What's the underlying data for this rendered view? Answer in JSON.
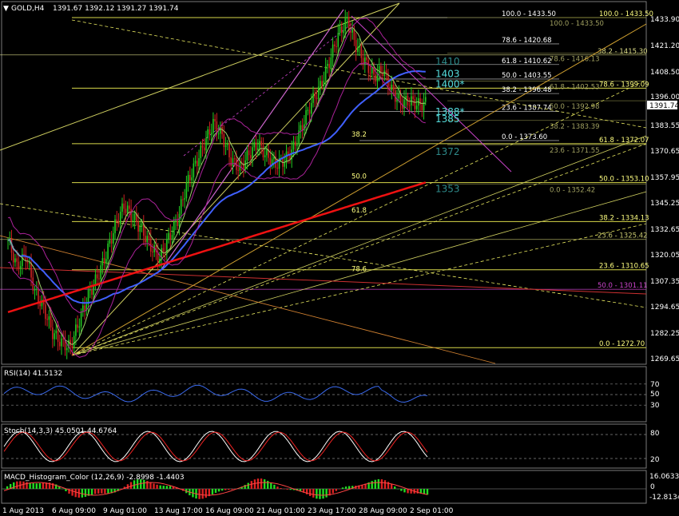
{
  "chart_data": {
    "type": "candlestick",
    "symbol_label": "GOLD,H4",
    "ohlc_label": "1391.67 1392.12 1391.27 1391.74",
    "last_price": "1391.74",
    "price_axis": [
      "1433.90",
      "1421.20",
      "1408.50",
      "1396.00",
      "1383.55",
      "1370.65",
      "1357.95",
      "1345.25",
      "1332.65",
      "1320.05",
      "1307.35",
      "1294.65",
      "1282.25",
      "1269.65"
    ],
    "time_axis": [
      "1 Aug 2013",
      "6 Aug 09:00",
      "9 Aug 01:00",
      "13 Aug 17:00",
      "16 Aug 09:00",
      "21 Aug 01:00",
      "23 Aug 17:00",
      "28 Aug 09:00",
      "2 Sep 01:00"
    ],
    "price_range": [
      1265.0,
      1440.5
    ],
    "close_path": [
      1325,
      1312,
      1318,
      1300,
      1292,
      1280,
      1275,
      1273,
      1286,
      1298,
      1307,
      1318,
      1332,
      1342,
      1336,
      1330,
      1322,
      1316,
      1326,
      1335,
      1352,
      1362,
      1372,
      1382,
      1376,
      1364,
      1360,
      1367,
      1372,
      1366,
      1362,
      1364,
      1370,
      1381,
      1392,
      1400,
      1412,
      1425,
      1432,
      1420,
      1412,
      1405,
      1408,
      1398,
      1392,
      1393,
      1391,
      1392
    ],
    "fib_levels_gold": [
      {
        "label": "100.0 - 1433.50",
        "price": 1433.5
      },
      {
        "label": "78.6 - 1399.09",
        "price": 1399.09
      },
      {
        "label": "61.8 - 1372.07",
        "price": 1372.07
      },
      {
        "label": "50.0 - 1353.10",
        "price": 1353.1
      },
      {
        "label": "38.2 - 1334.13",
        "price": 1334.13
      },
      {
        "label": "23.6 - 1310.65",
        "price": 1310.65
      },
      {
        "label": "0.0 - 1272.70",
        "price": 1272.7
      }
    ],
    "fib_levels_white": [
      {
        "label": "100.0 - 1433.50",
        "price": 1433.5
      },
      {
        "label": "78.6 - 1420.68",
        "price": 1420.68
      },
      {
        "label": "61.8 - 1410.62",
        "price": 1410.62
      },
      {
        "label": "50.0 - 1403.55",
        "price": 1403.55
      },
      {
        "label": "38.2 - 1396.48",
        "price": 1396.48
      },
      {
        "label": "23.6 - 1387.74",
        "price": 1387.74
      },
      {
        "label": "0.0 - 1373.60",
        "price": 1373.6
      }
    ],
    "fib_levels_dim": [
      {
        "label": "100.0 - 1433.50",
        "price": 1433.5
      },
      {
        "label": "78.6 - 1416.13",
        "price": 1416.13
      },
      {
        "label": "61.8 - 1402.53",
        "price": 1402.53
      },
      {
        "label": "50.0 - 1392.98",
        "price": 1392.98
      },
      {
        "label": "38.2 - 1383.39",
        "price": 1383.39
      },
      {
        "label": "23.6 - 1371.55",
        "price": 1371.55
      },
      {
        "label": "0.0 - 1352.42",
        "price": 1352.42
      }
    ],
    "fib_levels_extra": [
      {
        "label": "38.2 - 1415.30",
        "price": 1415.3,
        "color": "#dddd88"
      },
      {
        "label": "23.6 - 1325.42",
        "price": 1325.42,
        "color": "#c8c870"
      },
      {
        "label": "50.0 - 1301.11",
        "price": 1301.11,
        "color": "#cc44cc"
      }
    ],
    "mid_fib_labels": [
      {
        "label": "38.2",
        "price": 1375.5
      },
      {
        "label": "50.0",
        "price": 1355.0
      },
      {
        "label": "61.8",
        "price": 1338.5
      },
      {
        "label": "78.6",
        "price": 1310.0
      }
    ],
    "level_marks": [
      {
        "label": "1410",
        "price": 1410.5,
        "color": "#2e8a8a"
      },
      {
        "label": "1403",
        "price": 1404.5,
        "color": "#55dddd"
      },
      {
        "label": "1400*",
        "price": 1399.5,
        "color": "#55dddd"
      },
      {
        "label": "1388*",
        "price": 1386.0,
        "color": "#55dddd"
      },
      {
        "label": "1385",
        "price": 1382.5,
        "color": "#55dddd"
      },
      {
        "label": "1372",
        "price": 1366.5,
        "color": "#2e8a8a"
      },
      {
        "label": "1353",
        "price": 1348.5,
        "color": "#2e8a8a"
      }
    ],
    "rsi": {
      "label": "RSI(14) 41.5132",
      "levels": [
        "70",
        "50",
        "30"
      ],
      "value": 41.5132
    },
    "stoch": {
      "label": "Stoch(14,3,3) 45.0501 44.6764",
      "levels": [
        "80",
        "20"
      ]
    },
    "macd": {
      "label": "MACD_Histogram_Color (12,26,9) -2.8998 -1.4403",
      "levels": [
        "16.0633",
        "0",
        "-12.8134"
      ]
    }
  }
}
